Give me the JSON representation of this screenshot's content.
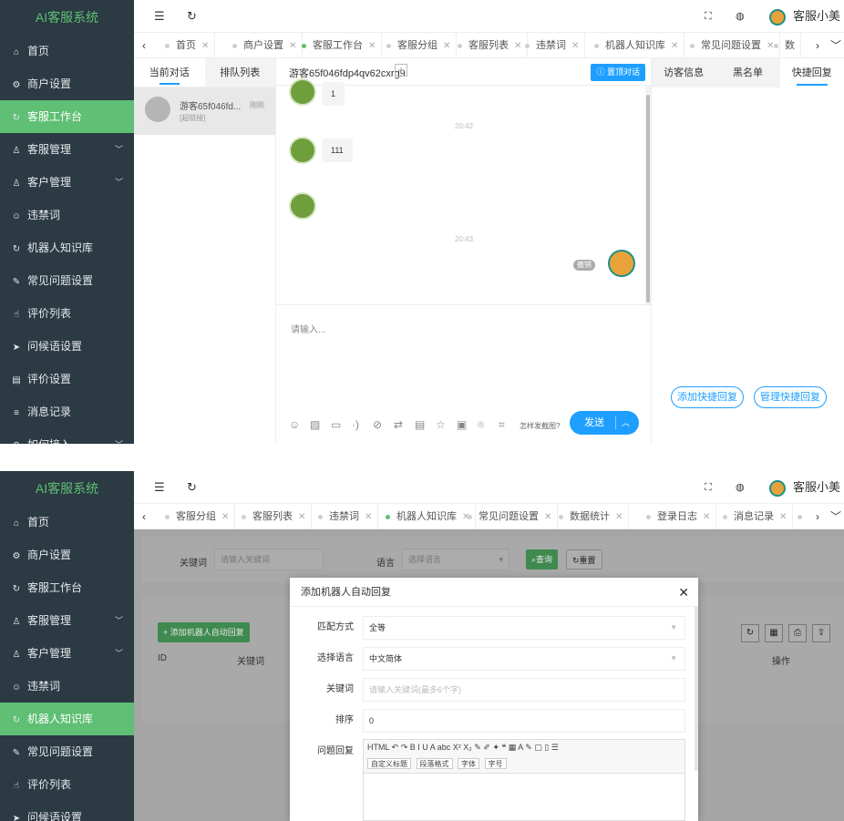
{
  "app": {
    "brand": "AI客服系统",
    "user_name": "客服小美"
  },
  "sidebar1": {
    "items": [
      {
        "label": "首页",
        "icon": "home-icon",
        "active": false,
        "has_arrow": false
      },
      {
        "label": "商户设置",
        "icon": "gear-icon",
        "active": false,
        "has_arrow": false
      },
      {
        "label": "客服工作台",
        "icon": "refresh-icon",
        "active": true,
        "has_arrow": false
      },
      {
        "label": "客服管理",
        "icon": "user-icon",
        "active": false,
        "has_arrow": true
      },
      {
        "label": "客户管理",
        "icon": "users-icon",
        "active": false,
        "has_arrow": true
      },
      {
        "label": "违禁词",
        "icon": "smile-icon",
        "active": false,
        "has_arrow": false
      },
      {
        "label": "机器人知识库",
        "icon": "refresh-icon",
        "active": false,
        "has_arrow": false
      },
      {
        "label": "常见问题设置",
        "icon": "edit-icon",
        "active": false,
        "has_arrow": false
      },
      {
        "label": "评价列表",
        "icon": "thumb-icon",
        "active": false,
        "has_arrow": false
      },
      {
        "label": "问候语设置",
        "icon": "send-icon",
        "active": false,
        "has_arrow": false
      },
      {
        "label": "评价设置",
        "icon": "calendar-icon",
        "active": false,
        "has_arrow": false
      },
      {
        "label": "消息记录",
        "icon": "list-icon",
        "active": false,
        "has_arrow": false
      },
      {
        "label": "如何接入",
        "icon": "link-icon",
        "active": false,
        "has_arrow": true
      }
    ]
  },
  "tabs1": [
    "首页",
    "商户设置",
    "客服工作台",
    "客服分组",
    "客服列表",
    "违禁词",
    "机器人知识库",
    "常见问题设置",
    "数"
  ],
  "tabs1_active": "客服工作台",
  "conversations": {
    "tab_current": "当前对话",
    "tab_queue": "排队列表",
    "items": [
      {
        "name": "游客65f046fd...",
        "status": "刚刚",
        "preview": "[超链接]"
      }
    ]
  },
  "chat": {
    "title": "游客65f046fdp4qv62cxrg9",
    "top_button": "置顶对话",
    "messages": [
      {
        "from": "visitor",
        "text": "1"
      },
      {
        "from": "time",
        "text": "20:42"
      },
      {
        "from": "visitor",
        "text": "111"
      },
      {
        "from": "visitor",
        "text": ""
      },
      {
        "from": "time",
        "text": "20:43"
      },
      {
        "from": "agent",
        "text": "",
        "badge": "撤销"
      }
    ],
    "input_placeholder": "请输入...",
    "screenshot_hint": "怎样发截图?",
    "send_label": "发送"
  },
  "right_panel": {
    "tabs": [
      "访客信息",
      "黑名单",
      "快捷回复"
    ],
    "active_tab": "快捷回复",
    "add_button": "添加快捷回复",
    "manage_button": "管理快捷回复"
  },
  "sidebar2": {
    "items": [
      {
        "label": "首页",
        "icon": "home-icon",
        "active": false,
        "has_arrow": false
      },
      {
        "label": "商户设置",
        "icon": "gear-icon",
        "active": false,
        "has_arrow": false
      },
      {
        "label": "客服工作台",
        "icon": "refresh-icon",
        "active": false,
        "has_arrow": false
      },
      {
        "label": "客服管理",
        "icon": "user-icon",
        "active": false,
        "has_arrow": true
      },
      {
        "label": "客户管理",
        "icon": "users-icon",
        "active": false,
        "has_arrow": true
      },
      {
        "label": "违禁词",
        "icon": "smile-icon",
        "active": false,
        "has_arrow": false
      },
      {
        "label": "机器人知识库",
        "icon": "refresh-icon",
        "active": true,
        "has_arrow": false
      },
      {
        "label": "常见问题设置",
        "icon": "edit-icon",
        "active": false,
        "has_arrow": false
      },
      {
        "label": "评价列表",
        "icon": "thumb-icon",
        "active": false,
        "has_arrow": false
      },
      {
        "label": "问候语设置",
        "icon": "send-icon",
        "active": false,
        "has_arrow": false
      }
    ]
  },
  "tabs2": [
    "客服分组",
    "客服列表",
    "违禁词",
    "机器人知识库",
    "常见问题设置",
    "数据统计",
    "登录日志",
    "消息记录",
    ""
  ],
  "tabs2_active": "机器人知识库",
  "kb_page": {
    "keyword_label": "关键词",
    "keyword_placeholder": "请输入关键词",
    "language_label": "语言",
    "language_placeholder": "选择语言",
    "search_button": "查询",
    "reset_button": "重置",
    "add_button": "添加机器人自动回复",
    "table_headers": [
      "ID",
      "关键词",
      "操作"
    ]
  },
  "modal": {
    "title": "添加机器人自动回复",
    "fields": {
      "match_label": "匹配方式",
      "match_value": "全等",
      "lang_label": "选择语言",
      "lang_value": "中文简体",
      "keyword_label": "关键词",
      "keyword_placeholder": "请输入关键词(最多6个字)",
      "sort_label": "排序",
      "sort_value": "0",
      "reply_label": "问题回复"
    },
    "editor": {
      "selects": [
        "自定义标题",
        "段落格式",
        "字体",
        "字号"
      ],
      "toolbar_glyphs": "HTML ↶ ↷ B I U A abc X² X₂ ✎ ✐ ✦ ❝ ▦ A ✎ ▢ ▯ ☰"
    }
  }
}
